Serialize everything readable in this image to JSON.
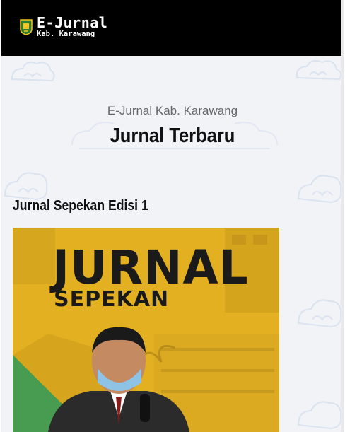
{
  "header": {
    "brand_title": "E-Jurnal",
    "brand_subtitle": "Kab. Karawang",
    "logo_icon": "karawang-emblem-icon",
    "background_color": "#000000"
  },
  "section": {
    "kicker": "E-Jurnal Kab. Karawang",
    "title": "Jurnal Terbaru"
  },
  "posts": [
    {
      "title": "Jurnal Sepekan Edisi 1",
      "image": {
        "headline": "JURNAL",
        "subheadline": "SEPEKAN",
        "background_color": "#e2b020"
      }
    }
  ]
}
